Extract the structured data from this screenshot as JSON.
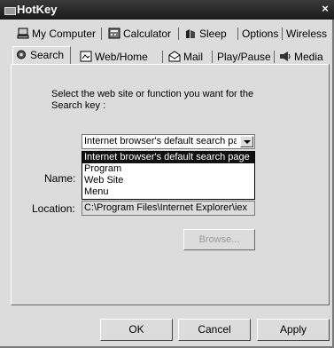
{
  "window": {
    "title": "HotKey",
    "close_glyph": "×"
  },
  "tabs_row1": [
    {
      "label": "My Computer",
      "icon": "computer-icon"
    },
    {
      "label": "Calculator",
      "icon": "calculator-icon"
    },
    {
      "label": "Sleep",
      "icon": "sleep-icon"
    },
    {
      "label": "Options",
      "icon": ""
    },
    {
      "label": "Wireless",
      "icon": ""
    }
  ],
  "tabs_row2": [
    {
      "label": "Search",
      "icon": "search-gear-icon",
      "active": true
    },
    {
      "label": "Web/Home",
      "icon": "web-home-icon"
    },
    {
      "label": "Mail",
      "icon": "mail-icon"
    },
    {
      "label": "Play/Pause",
      "icon": ""
    },
    {
      "label": "Media",
      "icon": "media-icon"
    }
  ],
  "search_panel": {
    "prompt": "Select the web site or function you want for the Search key :",
    "combo_value": "Internet browser's default search pa",
    "options": [
      "Internet browser's default search page",
      "Program",
      "Web Site",
      "Menu"
    ],
    "selected_option_index": 0,
    "name_label": "Name:",
    "location_label": "Location:",
    "location_value": "C:\\Program Files\\Internet Explorer\\iex",
    "browse_label": "Browse..."
  },
  "buttons": {
    "ok": "OK",
    "cancel": "Cancel",
    "apply": "Apply"
  }
}
